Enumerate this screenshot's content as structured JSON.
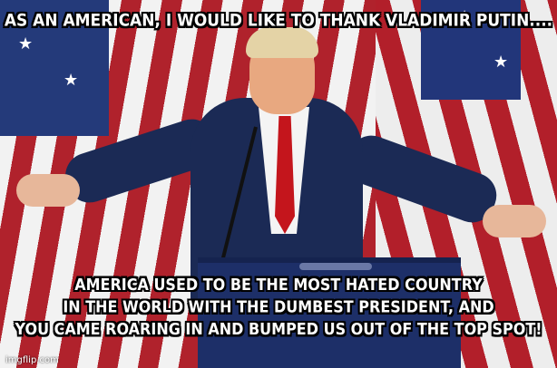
{
  "meme": {
    "top_text": "AS AN AMERICAN, I WOULD LIKE TO THANK VLADIMIR PUTIN....",
    "bottom_text": {
      "line1": "AMERICA USED TO BE THE MOST HATED COUNTRY",
      "line2": "IN THE WORLD WITH THE DUMBEST PRESIDENT, AND",
      "line3": "YOU CAME ROARING IN AND BUMPED US OUT OF THE TOP SPOT!"
    },
    "watermark": "imgflip.com"
  },
  "colors": {
    "flag_red": "#b0222c",
    "flag_white": "#f2f2f2",
    "flag_blue": "#243a7a",
    "suit": "#1b2a55",
    "tie": "#c4151c",
    "text": "#ffffff",
    "text_outline": "#000000"
  }
}
